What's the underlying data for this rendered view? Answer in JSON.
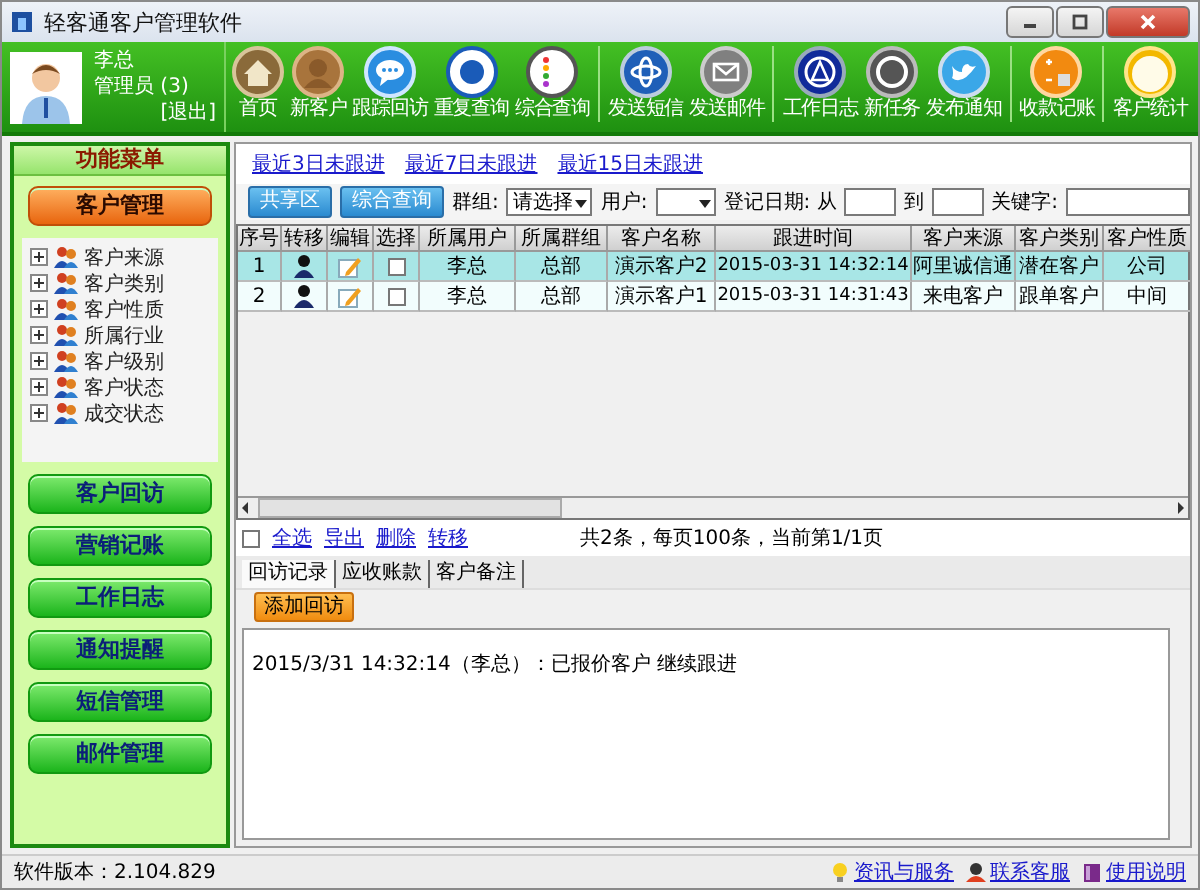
{
  "window": {
    "title": "轻客通客户管理软件"
  },
  "user": {
    "name": "李总",
    "role": "管理员 (3)",
    "logout": "[退出]"
  },
  "toolbar": {
    "groups": [
      {
        "items": [
          {
            "label": "首页",
            "kind": "home"
          },
          {
            "label": "新客户",
            "kind": "person"
          },
          {
            "label": "跟踪回访",
            "kind": "chat"
          },
          {
            "label": "重复查询",
            "kind": "dot"
          },
          {
            "label": "综合查询",
            "kind": "list"
          }
        ]
      },
      {
        "items": [
          {
            "label": "发送短信",
            "kind": "globe"
          },
          {
            "label": "发送邮件",
            "kind": "mail"
          }
        ]
      },
      {
        "items": [
          {
            "label": "工作日志",
            "kind": "triangle"
          },
          {
            "label": "新任务",
            "kind": "disc"
          },
          {
            "label": "发布通知",
            "kind": "bird"
          }
        ]
      },
      {
        "items": [
          {
            "label": "收款记账",
            "kind": "calculator"
          }
        ]
      },
      {
        "items": [
          {
            "label": "客户统计",
            "kind": "note"
          }
        ]
      }
    ]
  },
  "sidebar": {
    "title": "功能菜单",
    "modules": [
      {
        "label": "客户管理",
        "selected": true
      },
      {
        "label": "客户回访",
        "selected": false
      },
      {
        "label": "营销记账",
        "selected": false
      },
      {
        "label": "工作日志",
        "selected": false
      },
      {
        "label": "通知提醒",
        "selected": false
      },
      {
        "label": "短信管理",
        "selected": false
      },
      {
        "label": "邮件管理",
        "selected": false
      }
    ],
    "tree": [
      {
        "label": "客户来源",
        "expanded": false
      },
      {
        "label": "客户类别",
        "expanded": false
      },
      {
        "label": "客户性质",
        "expanded": false
      },
      {
        "label": "所属行业",
        "expanded": false
      },
      {
        "label": "客户级别",
        "expanded": false
      },
      {
        "label": "客户状态",
        "expanded": false
      },
      {
        "label": "成交状态",
        "expanded": false
      }
    ]
  },
  "quick_links": [
    "最近3日未跟进",
    "最近7日未跟进",
    "最近15日未跟进"
  ],
  "filters": {
    "buttons": [
      "共享区",
      "综合查询"
    ],
    "group_label": "群组:",
    "group_value": "请选择",
    "user_label": "用户:",
    "date_label": "登记日期: 从",
    "to_label": "到",
    "keyword_label": "关键字:"
  },
  "table": {
    "columns": [
      {
        "label": "序号",
        "kind": "text"
      },
      {
        "label": "转移",
        "kind": "transfer"
      },
      {
        "label": "编辑",
        "kind": "edit"
      },
      {
        "label": "选择",
        "kind": "check"
      },
      {
        "label": "所属用户",
        "kind": "text"
      },
      {
        "label": "所属群组",
        "kind": "text"
      },
      {
        "label": "客户名称",
        "kind": "text"
      },
      {
        "label": "跟进时间",
        "kind": "text"
      },
      {
        "label": "客户来源",
        "kind": "text"
      },
      {
        "label": "客户类别",
        "kind": "text"
      },
      {
        "label": "客户性质",
        "kind": "text"
      }
    ],
    "rows": [
      {
        "selected": true,
        "checked": false,
        "cells": [
          "1",
          "",
          "",
          "",
          "李总",
          "总部",
          "演示客户2",
          "2015-03-31 14:32:14",
          "阿里诚信通",
          "潜在客户",
          "公司"
        ]
      },
      {
        "selected": false,
        "checked": false,
        "cells": [
          "2",
          "",
          "",
          "",
          "李总",
          "总部",
          "演示客户1",
          "2015-03-31 14:31:43",
          "来电客户",
          "跟单客户",
          "中间"
        ]
      }
    ]
  },
  "grid_footer": {
    "select_all_checked": false,
    "actions": [
      "全选",
      "导出",
      "删除",
      "转移"
    ],
    "pagination": "共2条，每页100条，当前第1/1页"
  },
  "detail_tabs": [
    {
      "label": "回访记录",
      "selected": true
    },
    {
      "label": "应收账款",
      "selected": false
    },
    {
      "label": "客户备注",
      "selected": false
    }
  ],
  "add_button": "添加回访",
  "log": "2015/3/31 14:32:14（李总）：已报价客户 继续跟进",
  "status_bar": {
    "version": "软件版本：2.104.829",
    "links": [
      {
        "label": "资讯与服务",
        "kind": "bulb"
      },
      {
        "label": "联系客服",
        "kind": "person"
      },
      {
        "label": "使用说明",
        "kind": "book"
      }
    ]
  }
}
